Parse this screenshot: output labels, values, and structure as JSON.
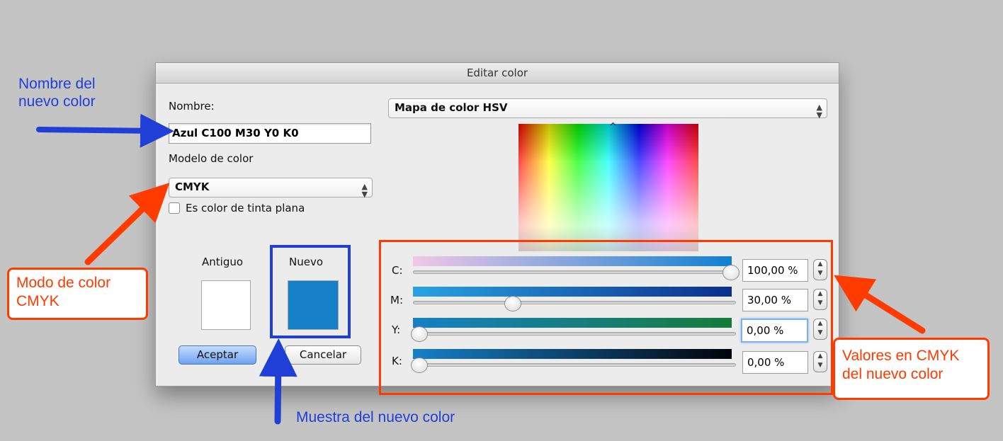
{
  "dialog": {
    "title": "Editar color",
    "name_label": "Nombre:",
    "name_value": "Azul C100 M30 Y0 K0",
    "model_label": "Modelo de color",
    "model_value": "CMYK",
    "spot_checkbox_label": "Es color de tinta plana",
    "spot_checked": false,
    "map_popup_value": "Mapa de color HSV",
    "old_label": "Antiguo",
    "new_label": "Nuevo",
    "old_color": "#ffffff",
    "new_color": "#1580c8",
    "accept_label": "Aceptar",
    "cancel_label": "Cancelar",
    "sliders": [
      {
        "label": "C:",
        "value": "100,00 %",
        "level": 1.0
      },
      {
        "label": "M:",
        "value": "30,00 %",
        "level": 0.3
      },
      {
        "label": "Y:",
        "value": "0,00 %",
        "level": 0.0
      },
      {
        "label": "K:",
        "value": "0,00 %",
        "level": 0.0
      }
    ]
  },
  "annotations": {
    "name_note": "Nombre del nuevo color",
    "name_note_line1": "Nombre del",
    "name_note_line2": "nuevo color",
    "mode_note_line1": "Modo de color",
    "mode_note_line2": "CMYK",
    "values_note_line1": "Valores en CMYK",
    "values_note_line2": "del nuevo color",
    "sample_note": "Muestra del nuevo color"
  },
  "colors": {
    "annotation_orange": "#ff3b00",
    "annotation_blue": "#1f3fd6",
    "default_button": "#6fa3f0"
  }
}
